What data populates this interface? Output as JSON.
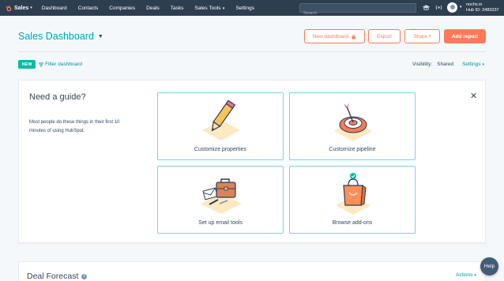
{
  "nav": {
    "brand": "Sales",
    "items": [
      {
        "label": "Dashboard"
      },
      {
        "label": "Contacts"
      },
      {
        "label": "Companies"
      },
      {
        "label": "Deals"
      },
      {
        "label": "Tasks"
      },
      {
        "label": "Sales Tools"
      },
      {
        "label": "Settings"
      }
    ],
    "search_placeholder": "Search",
    "account_name": "nochs.in",
    "hub_id": "Hub ID: 3489337"
  },
  "header": {
    "title": "Sales Dashboard",
    "new_dashboard_label": "New dashboard",
    "export_label": "Export",
    "share_label": "Share",
    "add_report_label": "Add report"
  },
  "filters": {
    "new_badge": "NEW",
    "filter_label": "Filter dashboard",
    "visibility_label": "Visibility:",
    "visibility_value": "Shared",
    "settings_label": "Settings"
  },
  "guide": {
    "title": "Need a guide?",
    "description": "Most people do these things in their first 10 minutes of using HubSpot.",
    "tiles": [
      {
        "label": "Customize properties",
        "icon": "pencil-icon"
      },
      {
        "label": "Customize pipeline",
        "icon": "target-icon"
      },
      {
        "label": "Set up email tools",
        "icon": "briefcase-icon"
      },
      {
        "label": "Browse add-ons",
        "icon": "shopping-bag-icon"
      }
    ]
  },
  "forecast": {
    "title": "Deal Forecast",
    "actions_label": "Actions"
  },
  "help_label": "Help",
  "colors": {
    "nav_bg": "#2d3e50",
    "accent_orange": "#ff7a59",
    "accent_teal": "#00a4bd",
    "link": "#0091ae",
    "new_badge": "#00bda5"
  }
}
